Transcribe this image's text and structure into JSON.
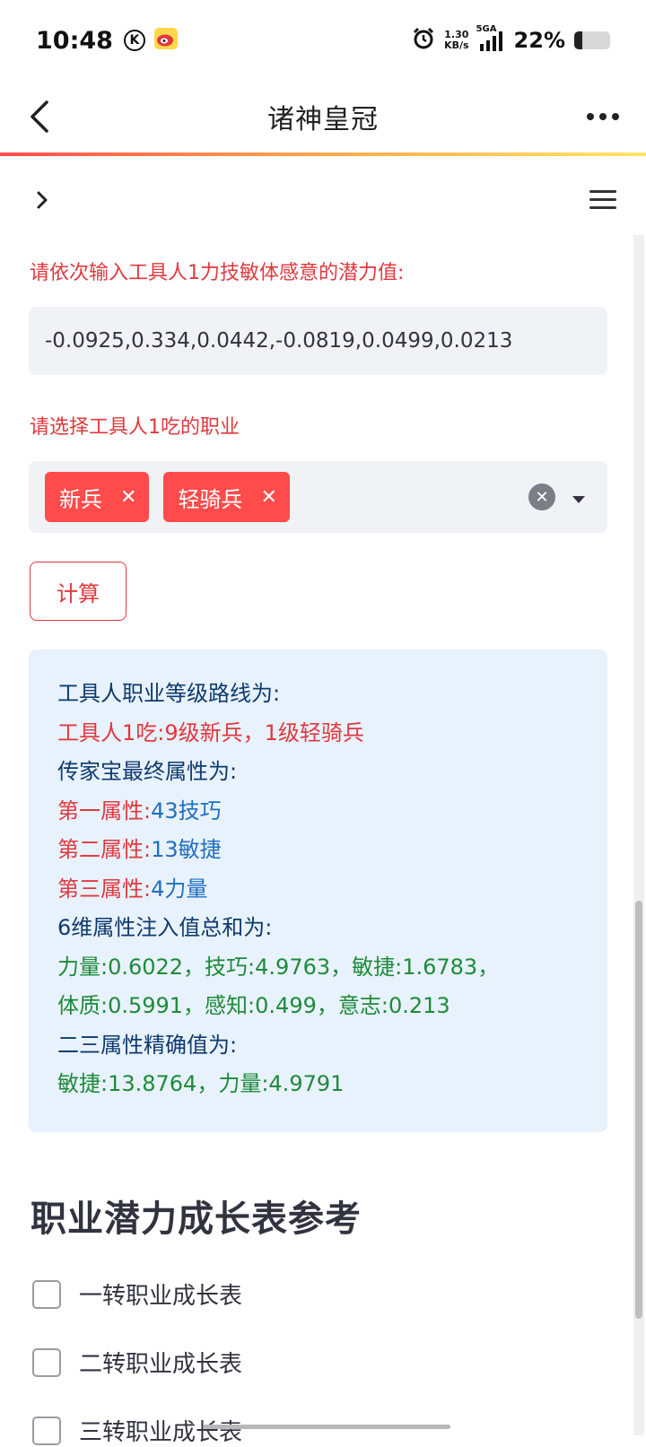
{
  "status_bar": {
    "time": "10:48",
    "k_badge": "K",
    "net_speed_value": "1.30",
    "net_speed_unit": "KB/s",
    "network_type": "5GA",
    "battery_percent": "22%",
    "battery_level": 0.22,
    "icons": [
      "k-circle-icon",
      "weibo-icon",
      "alarm-icon",
      "signal-icon",
      "battery-icon"
    ]
  },
  "header": {
    "title": "诸神皇冠",
    "icons": [
      "back-arrow-icon",
      "more-dots-icon"
    ]
  },
  "toolbar": {
    "icons": [
      "chevron-right-icon",
      "hamburger-menu-icon"
    ]
  },
  "form": {
    "potential_label": "请依次输入工具人1力技敏体感意的潜力值:",
    "potential_value": "-0.0925,0.334,0.0442,-0.0819,0.0499,0.0213",
    "job_label": "请选择工具人1吃的职业",
    "selected_jobs": [
      {
        "label": "新兵",
        "remove": "✕"
      },
      {
        "label": "轻骑兵",
        "remove": "✕"
      }
    ],
    "calc_button": "计算"
  },
  "result": {
    "route_title": "工具人职业等级路线为:",
    "route_label": "工具人1吃:",
    "route_value": "9级新兵，1级轻骑兵",
    "heirloom_title": "传家宝最终属性为:",
    "attr1_label": "第一属性:",
    "attr1_value": "43技巧",
    "attr2_label": "第二属性:",
    "attr2_value": "13敏捷",
    "attr3_label": "第三属性:",
    "attr3_value": "4力量",
    "sum_title": "6维属性注入值总和为:",
    "sum_line1": "力量:0.6022，技巧:4.9763，敏捷:1.6783，",
    "sum_line2": "体质:0.5991，感知:0.499，意志:0.213",
    "exact_title": "二三属性精确值为:",
    "exact_line": "敏捷:13.8764，力量:4.9791"
  },
  "reference": {
    "heading": "职业潜力成长表参考",
    "items": [
      {
        "label": "一转职业成长表",
        "checked": false
      },
      {
        "label": "二转职业成长表",
        "checked": false
      },
      {
        "label": "三转职业成长表",
        "checked": false
      }
    ]
  },
  "colors": {
    "accent_red": "#ff4b4b",
    "label_red": "#e0383e",
    "info_bg": "#e8f2fc",
    "text_dark_blue": "#0e3a6e",
    "text_blue": "#1f6fc2",
    "text_green": "#1e8a3a",
    "input_bg": "#f0f2f6"
  }
}
